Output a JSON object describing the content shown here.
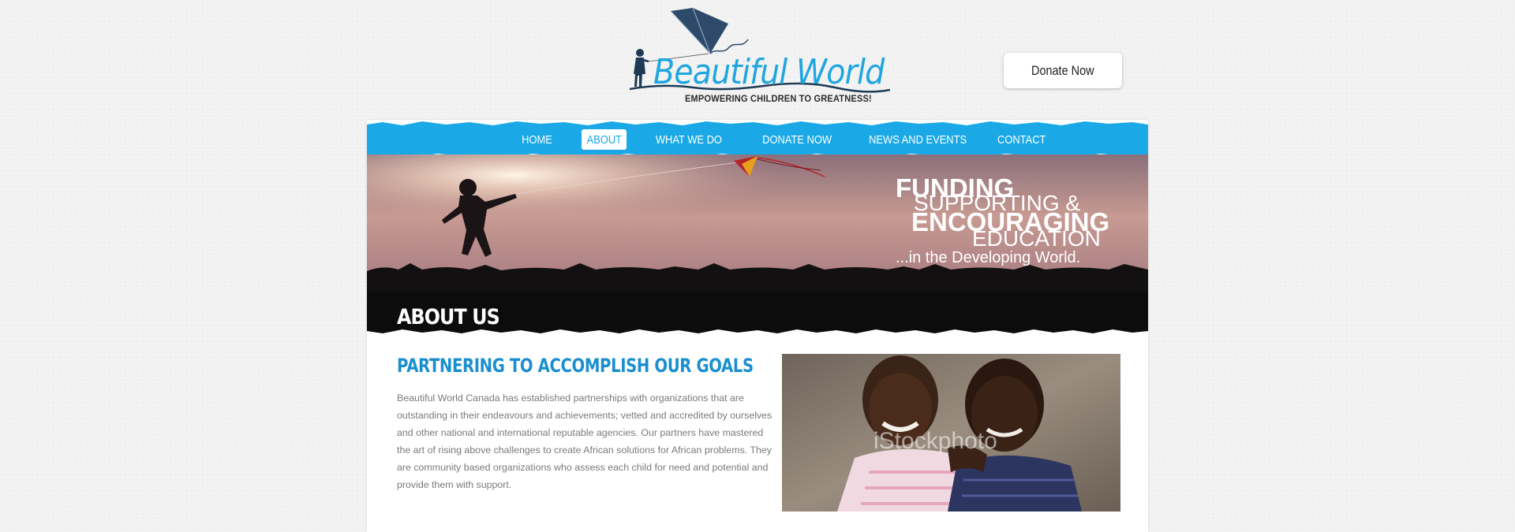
{
  "header": {
    "logo_title": "Beautiful World",
    "logo_tagline": "EMPOWERING CHILDREN TO GREATNESS!",
    "donate_label": "Donate Now"
  },
  "nav": {
    "items": [
      {
        "label": "HOME"
      },
      {
        "label": "ABOUT"
      },
      {
        "label": "WHAT WE DO"
      },
      {
        "label": "DONATE NOW"
      },
      {
        "label": "NEWS AND EVENTS"
      },
      {
        "label": "CONTACT"
      }
    ],
    "active": "ABOUT"
  },
  "hero": {
    "line1": "FUNDING",
    "line2": "SUPPORTING &",
    "line3": "ENCOURAGING",
    "line4": "EDUCATION",
    "line5": "...in the Developing World."
  },
  "about": {
    "band_title": "ABOUT US",
    "heading": "PARTNERING TO ACCOMPLISH OUR GOALS",
    "body": "Beautiful World Canada has established partnerships with organizations that are outstanding in their endeavours and achievements; vetted and accredited by ourselves and other national and international reputable agencies. Our partners have mastered the art of rising above challenges to create African solutions for African problems. They are community based organizations who assess each child for need and potential and provide them with support.",
    "photo_watermark": "iStockphoto"
  },
  "colors": {
    "brand_blue": "#1aa9e6",
    "heading_blue": "#1a8fcf",
    "body_text": "#7a7a7a"
  }
}
